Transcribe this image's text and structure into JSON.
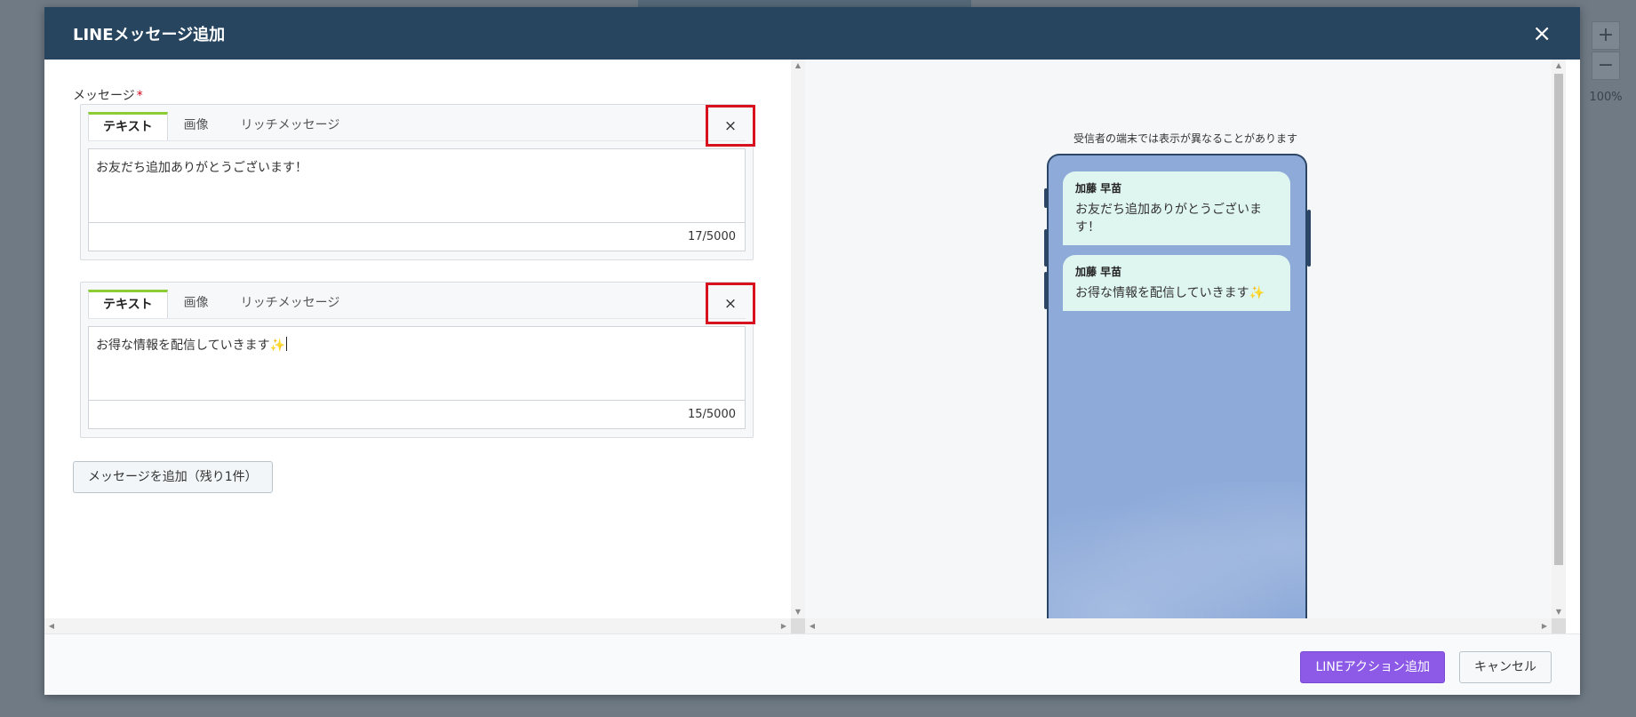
{
  "background": {
    "zoom_in": "+",
    "zoom_out": "−",
    "zoom_level": "100%"
  },
  "modal": {
    "title": "LINEメッセージ追加",
    "close_icon": "×"
  },
  "form": {
    "message_label": "メッセージ",
    "required_mark": "*",
    "tabs": [
      "テキスト",
      "画像",
      "リッチメッセージ"
    ],
    "remove_icon": "×",
    "messages": [
      {
        "text": "お友だち追加ありがとうございます！",
        "counter": "17/5000"
      },
      {
        "text": "お得な情報を配信していきます✨",
        "counter": "15/5000"
      }
    ],
    "add_button": "メッセージを追加（残り1件）"
  },
  "preview": {
    "note": "受信者の端末では表示が異なることがあります",
    "bubbles": [
      {
        "sender": "加藤 早苗",
        "text": "お友だち追加ありがとうございます！"
      },
      {
        "sender": "加藤 早苗",
        "text": "お得な情報を配信していきます✨"
      }
    ]
  },
  "footer": {
    "primary_button": "LINEアクション追加",
    "cancel_button": "キャンセル"
  },
  "colors": {
    "header": "#27455f",
    "tab_accent": "#8ccd36",
    "highlight": "#d8111f",
    "primary": "#8c5ae6",
    "bubble": "#dff5ef",
    "phone_bg": "#8daad9"
  }
}
